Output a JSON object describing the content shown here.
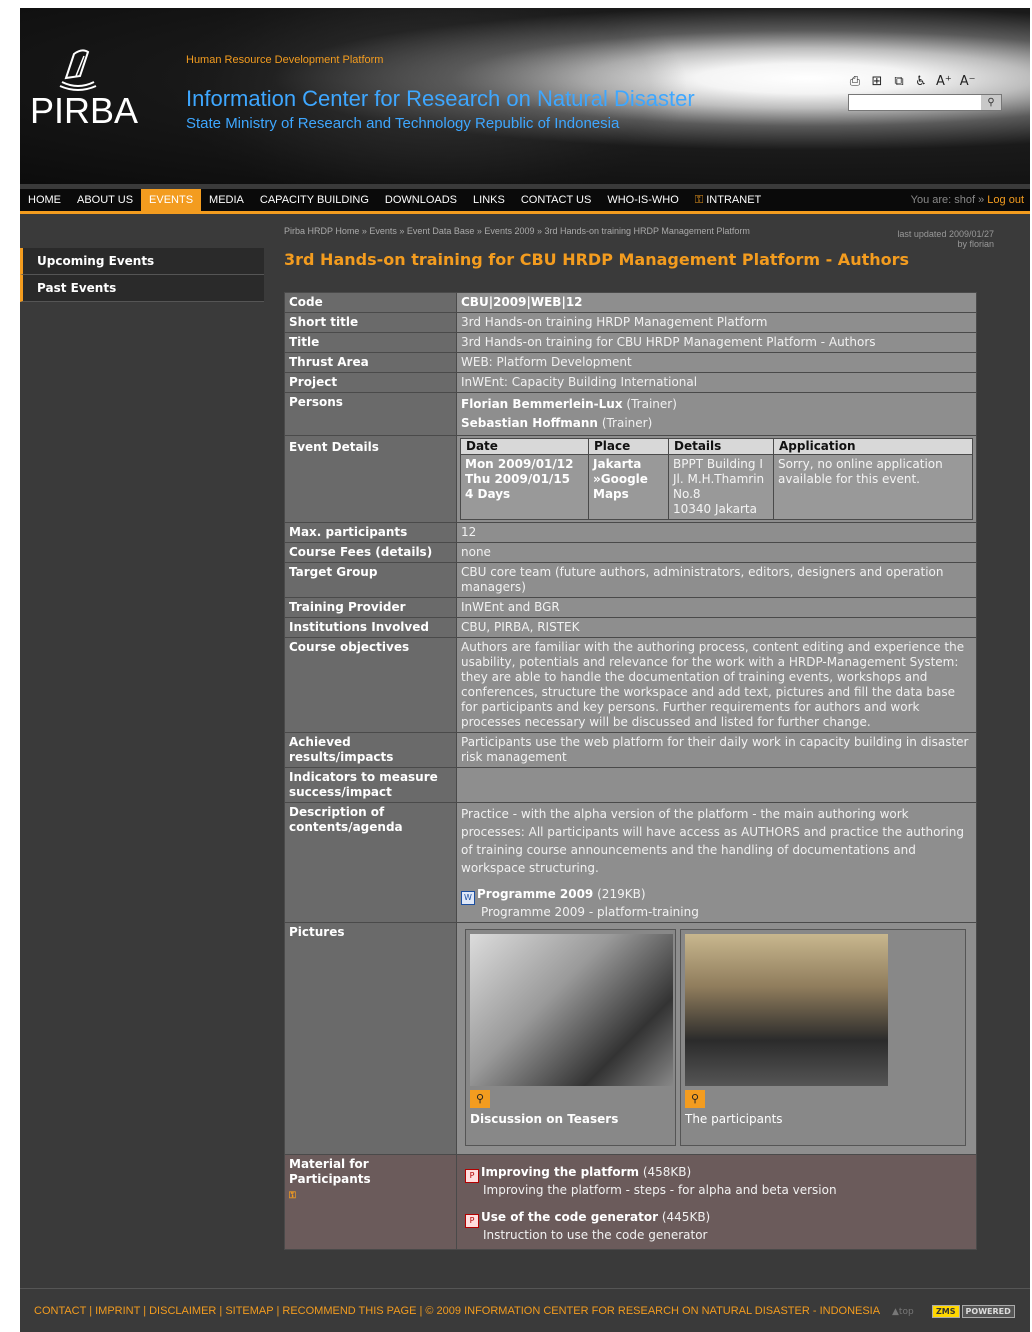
{
  "header": {
    "logo_text": "PIRBA",
    "platform": "Human Resource Development Platform",
    "title": "Information Center for Research on Natural Disaster",
    "subtitle": "State Ministry of Research and Technology Republic of Indonesia",
    "tools": [
      "print-icon",
      "sitemap-icon",
      "window-icon",
      "accessibility-icon",
      "A+",
      "A-"
    ],
    "font_increase": "A⁺",
    "font_decrease": "A⁻"
  },
  "nav": {
    "items": [
      "HOME",
      "ABOUT US",
      "EVENTS",
      "MEDIA",
      "CAPACITY BUILDING",
      "DOWNLOADS",
      "LINKS",
      "CONTACT US",
      "WHO-IS-WHO",
      "INTRANET"
    ],
    "active": "EVENTS",
    "user_prefix": "You are: shof » ",
    "logout": "Log out"
  },
  "sidebar": {
    "items": [
      "Upcoming Events",
      "Past Events"
    ]
  },
  "breadcrumb": "Pirba HRDP Home » Events » Event Data Base » Events 2009 » 3rd Hands-on training HRDP Management Platform",
  "last_updated": "last updated 2009/01/27",
  "updated_by": "by florian",
  "page_title": "3rd Hands-on training for CBU HRDP Management Platform - Authors",
  "fields": {
    "code_k": "Code",
    "code_v": "CBU|2009|WEB|12",
    "short_title_k": "Short title",
    "short_title_v": "3rd Hands-on training HRDP Management Platform",
    "title_k": "Title",
    "title_v": "3rd Hands-on training for CBU HRDP Management Platform - Authors",
    "thrust_k": "Thrust Area",
    "thrust_v": "WEB: Platform Development",
    "project_k": "Project",
    "project_v": "InWEnt: Capacity Building International",
    "persons_k": "Persons",
    "person1": "Florian Bemmerlein-Lux",
    "person1_role": "(Trainer)",
    "person2": "Sebastian Hoffmann",
    "person2_role": "(Trainer)",
    "event_k": "Event Details",
    "ev_head": [
      "Date",
      "Place",
      "Details",
      "Application"
    ],
    "ev_date1": "Mon 2009/01/12",
    "ev_date2": "Thu 2009/01/15",
    "ev_days": "4 Days",
    "ev_place1": "Jakarta",
    "ev_place2": "»Google",
    "ev_place3": "Maps",
    "ev_det1": "BPPT Building I",
    "ev_det2": "Jl. M.H.Thamrin",
    "ev_det3": "No.8",
    "ev_det4": "10340 Jakarta",
    "ev_app": "Sorry, no online application available for this event.",
    "max_k": "Max. participants",
    "max_v": "12",
    "fees_k": "Course Fees (details)",
    "fees_v": "none",
    "target_k": "Target Group",
    "target_v": "CBU core team (future authors, administrators, editors, designers and operation managers)",
    "provider_k": "Training Provider",
    "provider_v": "InWEnt and BGR",
    "inst_k": "Institutions Involved",
    "inst_v": "CBU, PIRBA, RISTEK",
    "obj_k": "Course objectives",
    "obj_v": "Authors are familiar with the authoring process, content editing and experience the usability, potentials and relevance for the work with a HRDP-Management System: they are able to handle the documentation of training events, workshops and conferences, structure the workspace and add text, pictures and fill the data base for participants and key persons. Further requirements for authors and work processes necessary will be discussed and listed for further change.",
    "results_k": "Achieved results/impacts",
    "results_v": "Participants use the web platform for their daily work in capacity building in disaster risk management",
    "indicators_k": "Indicators to measure success/impact",
    "indicators_v": "",
    "desc_k": "Description of contents/agenda",
    "desc_v": "Practice - with the alpha version of the platform - the main authoring work processes: All participants will have access as AUTHORS and practice the authoring of training course announcements and the handling of documentations and workspace structuring.",
    "prog_name": "Programme 2009",
    "prog_size": "(219KB)",
    "prog_desc": "Programme 2009 - platform-training",
    "pictures_k": "Pictures",
    "pic1_cap": "Discussion on Teasers",
    "pic2_cap": "The participants",
    "material_k": "Material for Participants",
    "mat1_name": "Improving the platform",
    "mat1_size": "(458KB)",
    "mat1_desc": "Improving the platform - steps - for alpha and beta version",
    "mat2_name": "Use of the code generator",
    "mat2_size": "(445KB)",
    "mat2_desc": "Instruction to use the code generator"
  },
  "footer": {
    "links": "CONTACT | IMPRINT | DISCLAIMER | SITEMAP | RECOMMEND THIS PAGE | © 2009 INFORMATION CENTER FOR RESEARCH ON NATURAL DISASTER - INDONESIA",
    "top": "▲top",
    "zms": "ZMS",
    "powered": "POWERED"
  },
  "colors": {
    "accent": "#f39c1f",
    "title_blue": "#3ea7ff",
    "background": "#3a3a3a"
  }
}
